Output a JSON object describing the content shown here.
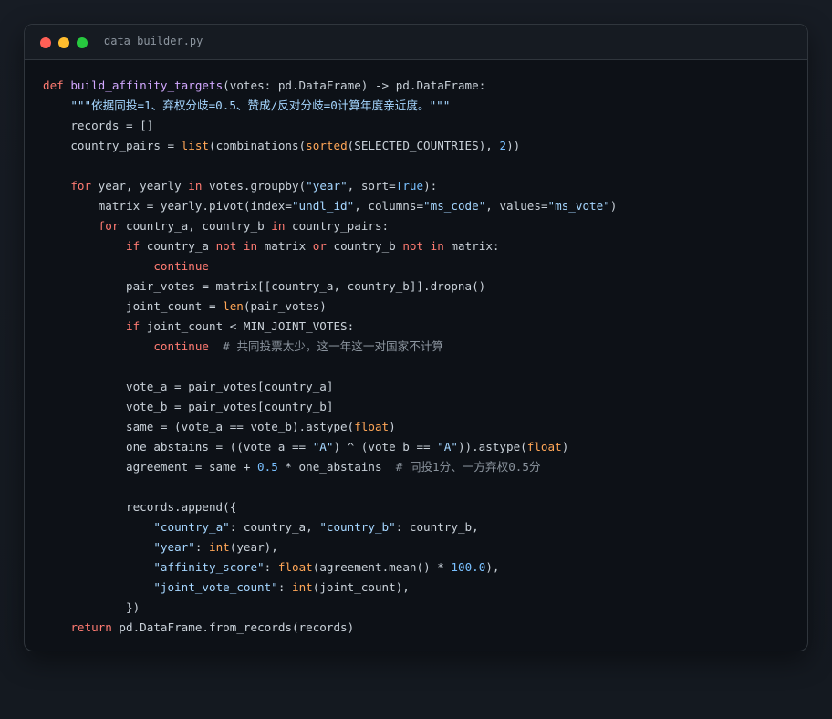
{
  "window": {
    "filename": "data_builder.py",
    "colors": {
      "background": "#0d1117",
      "keyword": "#ff7b72",
      "function": "#d2a8ff",
      "string": "#a5d6ff",
      "builtin": "#ffa657",
      "constant": "#79c0ff",
      "comment": "#8b949e",
      "text": "#c9d1d9"
    }
  },
  "code": {
    "lines": [
      [
        [
          "kw",
          "def "
        ],
        [
          "fn",
          "build_affinity_targets"
        ],
        [
          "tx",
          "(votes: pd.DataFrame) -> pd.DataFrame:"
        ]
      ],
      [
        [
          "tx",
          "    "
        ],
        [
          "str",
          "\"\"\"依据同投=1、弃权分歧=0.5、赞成/反对分歧=0计算年度亲近度。\"\"\""
        ]
      ],
      [
        [
          "tx",
          "    records = []"
        ]
      ],
      [
        [
          "tx",
          "    country_pairs = "
        ],
        [
          "bi",
          "list"
        ],
        [
          "tx",
          "(combinations("
        ],
        [
          "bi",
          "sorted"
        ],
        [
          "tx",
          "(SELECTED_COUNTRIES), "
        ],
        [
          "num",
          "2"
        ],
        [
          "tx",
          "))"
        ]
      ],
      [
        [
          "tx",
          ""
        ]
      ],
      [
        [
          "tx",
          "    "
        ],
        [
          "kw",
          "for"
        ],
        [
          "tx",
          " year, yearly "
        ],
        [
          "kw",
          "in"
        ],
        [
          "tx",
          " votes.groupby("
        ],
        [
          "str",
          "\"year\""
        ],
        [
          "tx",
          ", sort="
        ],
        [
          "cst",
          "True"
        ],
        [
          "tx",
          "):"
        ]
      ],
      [
        [
          "tx",
          "        matrix = yearly.pivot(index="
        ],
        [
          "str",
          "\"undl_id\""
        ],
        [
          "tx",
          ", columns="
        ],
        [
          "str",
          "\"ms_code\""
        ],
        [
          "tx",
          ", values="
        ],
        [
          "str",
          "\"ms_vote\""
        ],
        [
          "tx",
          ")"
        ]
      ],
      [
        [
          "tx",
          "        "
        ],
        [
          "kw",
          "for"
        ],
        [
          "tx",
          " country_a, country_b "
        ],
        [
          "kw",
          "in"
        ],
        [
          "tx",
          " country_pairs:"
        ]
      ],
      [
        [
          "tx",
          "            "
        ],
        [
          "kw",
          "if"
        ],
        [
          "tx",
          " country_a "
        ],
        [
          "kw",
          "not in"
        ],
        [
          "tx",
          " matrix "
        ],
        [
          "kw",
          "or"
        ],
        [
          "tx",
          " country_b "
        ],
        [
          "kw",
          "not in"
        ],
        [
          "tx",
          " matrix:"
        ]
      ],
      [
        [
          "tx",
          "                "
        ],
        [
          "kw",
          "continue"
        ]
      ],
      [
        [
          "tx",
          "            pair_votes = matrix[[country_a, country_b]].dropna()"
        ]
      ],
      [
        [
          "tx",
          "            joint_count = "
        ],
        [
          "bi",
          "len"
        ],
        [
          "tx",
          "(pair_votes)"
        ]
      ],
      [
        [
          "tx",
          "            "
        ],
        [
          "kw",
          "if"
        ],
        [
          "tx",
          " joint_count < MIN_JOINT_VOTES:"
        ]
      ],
      [
        [
          "tx",
          "                "
        ],
        [
          "kw",
          "continue"
        ],
        [
          "tx",
          "  "
        ],
        [
          "com",
          "# 共同投票太少，这一年这一对国家不计算"
        ]
      ],
      [
        [
          "tx",
          ""
        ]
      ],
      [
        [
          "tx",
          "            vote_a = pair_votes[country_a]"
        ]
      ],
      [
        [
          "tx",
          "            vote_b = pair_votes[country_b]"
        ]
      ],
      [
        [
          "tx",
          "            same = (vote_a == vote_b).astype("
        ],
        [
          "bi",
          "float"
        ],
        [
          "tx",
          ")"
        ]
      ],
      [
        [
          "tx",
          "            one_abstains = ((vote_a == "
        ],
        [
          "str",
          "\"A\""
        ],
        [
          "tx",
          ") ^ (vote_b == "
        ],
        [
          "str",
          "\"A\""
        ],
        [
          "tx",
          ")).astype("
        ],
        [
          "bi",
          "float"
        ],
        [
          "tx",
          ")"
        ]
      ],
      [
        [
          "tx",
          "            agreement = same + "
        ],
        [
          "num",
          "0.5"
        ],
        [
          "tx",
          " * one_abstains  "
        ],
        [
          "com",
          "# 同投1分、一方弃权0.5分"
        ]
      ],
      [
        [
          "tx",
          ""
        ]
      ],
      [
        [
          "tx",
          "            records.append({"
        ]
      ],
      [
        [
          "tx",
          "                "
        ],
        [
          "str",
          "\"country_a\""
        ],
        [
          "tx",
          ": country_a, "
        ],
        [
          "str",
          "\"country_b\""
        ],
        [
          "tx",
          ": country_b,"
        ]
      ],
      [
        [
          "tx",
          "                "
        ],
        [
          "str",
          "\"year\""
        ],
        [
          "tx",
          ": "
        ],
        [
          "bi",
          "int"
        ],
        [
          "tx",
          "(year),"
        ]
      ],
      [
        [
          "tx",
          "                "
        ],
        [
          "str",
          "\"affinity_score\""
        ],
        [
          "tx",
          ": "
        ],
        [
          "bi",
          "float"
        ],
        [
          "tx",
          "(agreement.mean() * "
        ],
        [
          "num",
          "100.0"
        ],
        [
          "tx",
          "),"
        ]
      ],
      [
        [
          "tx",
          "                "
        ],
        [
          "str",
          "\"joint_vote_count\""
        ],
        [
          "tx",
          ": "
        ],
        [
          "bi",
          "int"
        ],
        [
          "tx",
          "(joint_count),"
        ]
      ],
      [
        [
          "tx",
          "            })"
        ]
      ],
      [
        [
          "tx",
          "    "
        ],
        [
          "kw",
          "return"
        ],
        [
          "tx",
          " pd.DataFrame.from_records(records)"
        ]
      ]
    ]
  }
}
